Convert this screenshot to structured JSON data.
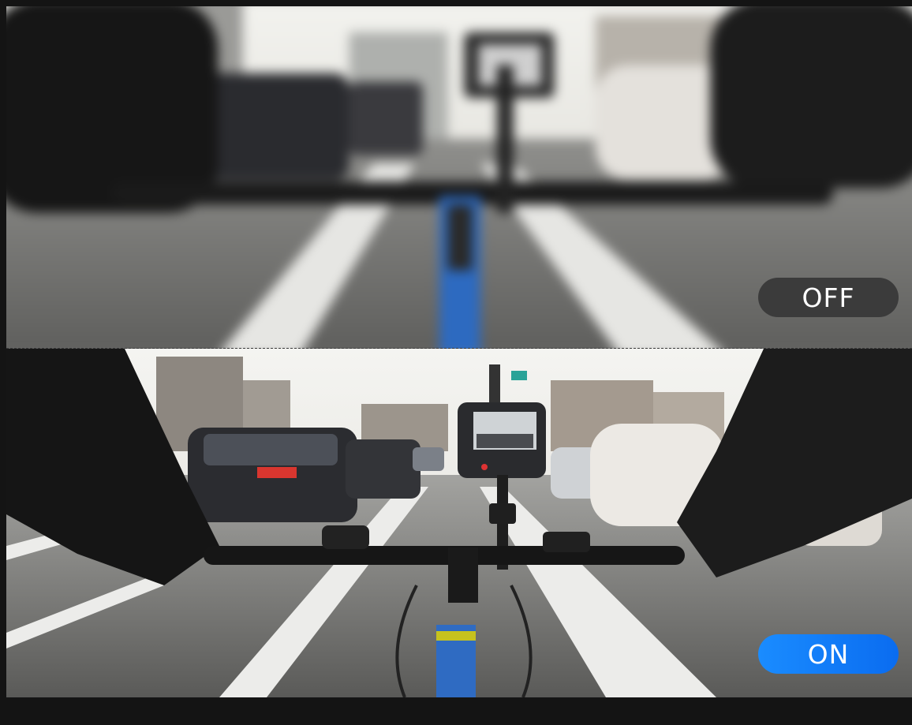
{
  "comparison": {
    "top": {
      "badge_label": "OFF",
      "badge_color": "#3b3b3b"
    },
    "bottom": {
      "badge_label": "ON",
      "badge_color": "#1a8cff"
    }
  }
}
